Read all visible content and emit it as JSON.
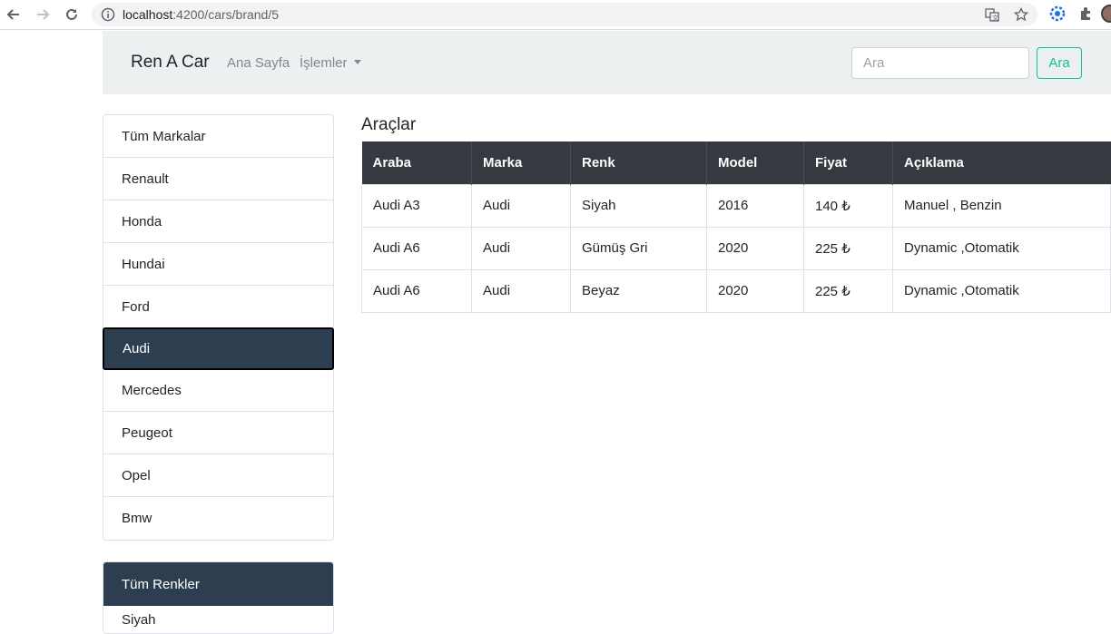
{
  "browser": {
    "url_host": "localhost",
    "url_path": ":4200/cars/brand/5"
  },
  "navbar": {
    "brand": "Ren A Car",
    "home_link": "Ana Sayfa",
    "operations_link": "İşlemler",
    "search_placeholder": "Ara",
    "search_button": "Ara"
  },
  "brands": {
    "items": [
      "Tüm Markalar",
      "Renault",
      "Honda",
      "Hundai",
      "Ford",
      "Audi",
      "Mercedes",
      "Peugeot",
      "Opel",
      "Bmw"
    ],
    "active": "Audi"
  },
  "colors": {
    "header": "Tüm Renkler",
    "first_item": "Siyah"
  },
  "cars": {
    "title": "Araçlar",
    "columns": [
      "Araba",
      "Marka",
      "Renk",
      "Model",
      "Fiyat",
      "Açıklama"
    ],
    "rows": [
      [
        "Audi A3",
        "Audi",
        "Siyah",
        "2016",
        "140 ₺",
        "Manuel , Benzin"
      ],
      [
        "Audi A6",
        "Audi",
        "Gümüş Gri",
        "2020",
        "225 ₺",
        "Dynamic ,Otomatik"
      ],
      [
        "Audi A6",
        "Audi",
        "Beyaz",
        "2020",
        "225 ₺",
        "Dynamic ,Otomatik"
      ]
    ]
  },
  "theme": {
    "primary": "#2c3e50",
    "navbar_bg": "#ecf0f1",
    "success": "#18bc9c",
    "table_head": "#343a40"
  }
}
